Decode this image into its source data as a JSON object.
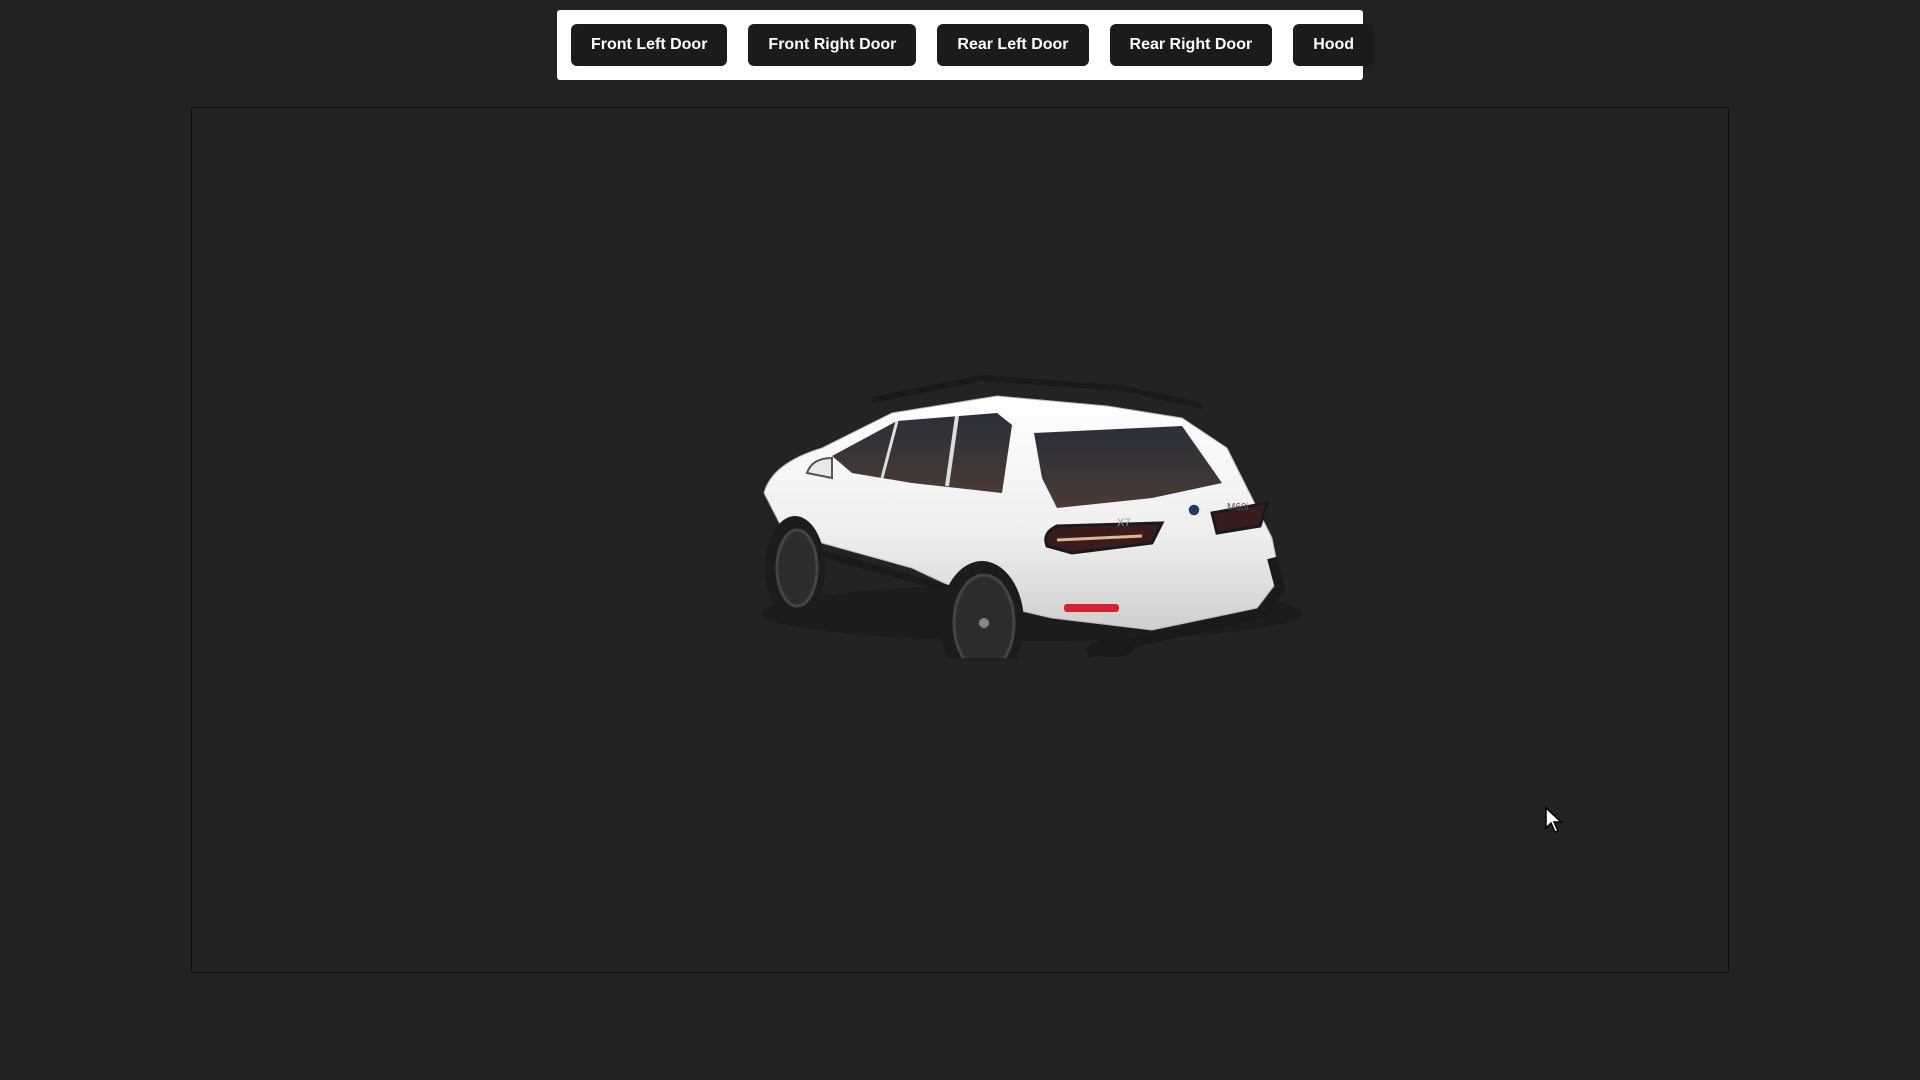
{
  "toolbar": {
    "buttons": [
      {
        "label": "Front Left Door"
      },
      {
        "label": "Front Right Door"
      },
      {
        "label": "Rear Left Door"
      },
      {
        "label": "Rear Right Door"
      },
      {
        "label": "Hood"
      }
    ]
  },
  "viewer": {
    "model_icon": "white-suv-3d-model",
    "badge_text": "X7",
    "trim_badge": "M60i"
  },
  "colors": {
    "page_background": "#222222",
    "toolbar_background": "#ffffff",
    "button_background": "#1b1b1b",
    "button_text": "#ffffff",
    "car_body": "#f2f2f2"
  }
}
